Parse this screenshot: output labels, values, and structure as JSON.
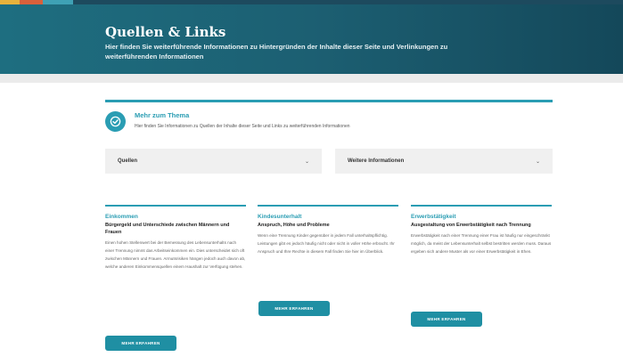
{
  "colors": {
    "accent": "#2a9db3",
    "hero_start": "#1e6e80",
    "hero_end": "#14485a",
    "stripe_yellow": "#e8b23b",
    "stripe_orange": "#d9603b",
    "stripe_teal": "#3fa1b5",
    "stripe_navy": "#1d4a5e"
  },
  "hero": {
    "title": "Quellen & Links",
    "subtitle": "Hier finden Sie weiterführende Informationen zu Hintergründen der Inhalte dieser Seite und Verlinkungen zu weiterführenden Informationen"
  },
  "intro": {
    "icon": "check-circle-icon",
    "title": "Mehr zum Thema",
    "text": "Hier finden Sie Informationen zu Quellen der Inhalte dieser Seite und Links zu weiterführenden Informationen"
  },
  "dropdowns": [
    {
      "label": "Quellen",
      "icon": "chevron-down-icon"
    },
    {
      "label": "Weitere Informationen",
      "icon": "chevron-down-icon"
    }
  ],
  "cards": [
    {
      "title": "Einkommen",
      "subtitle": "Bürgergeld und Unterschiede zwischen Männern und Frauen",
      "body": "Einen hohen Stellenwert bei der Bemessung des Lebensunterhalts nach einer Trennung nimmt das Arbeitseinkommen ein. Dies unterscheidet sich oft zwischen Männern und Frauen. Armutsrisiken hängen jedoch auch davon ab, welche anderen Einkommensquellen einem Haushalt zur Verfügung stehen.",
      "button": "MEHR ERFAHREN"
    },
    {
      "title": "Kindesunterhalt",
      "subtitle": "Anspruch, Höhe und Probleme",
      "body": "Wenn eine Trennung Kinder gegenüber in jedem Fall unterhaltspflichtig. Leistungen gibt es jedoch häufig nicht oder nicht in voller Höhe erbracht. Ihr Anspruch und Ihre Rechte in diesem Fall finden Sie hier im Überblick.",
      "button": "MEHR ERFAHREN"
    },
    {
      "title": "Erwerbstätigkeit",
      "subtitle": "Ausgestaltung von Erwerbstätigkeit nach Trennung",
      "body": "Erwerbstätigkeit nach einer Trennung einer Frau ist häufig nur eingeschränkt möglich, da meist der Lebensunterhalt selbst bestritten werden muss. Daraus ergeben sich andere Muster als vor einer Erwerbstätigkeit in Ehen.",
      "button": "MEHR ERFAHREN"
    }
  ]
}
